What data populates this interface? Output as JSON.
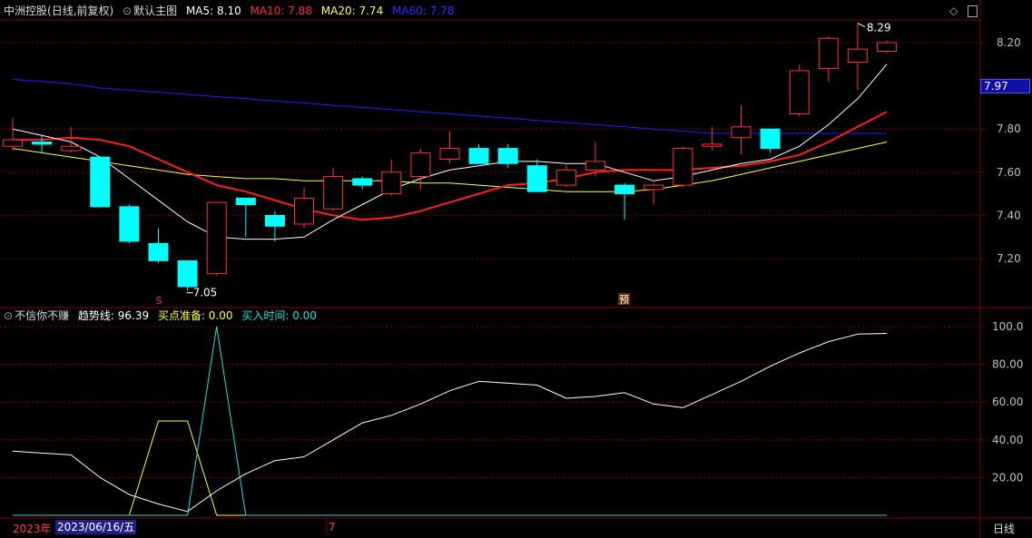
{
  "main_header": {
    "name": "中洲控股",
    "period": "(日线,前复权)",
    "chart_name": "默认主图",
    "ma5": "MA5: 8.10",
    "ma10": "MA10: 7.88",
    "ma20": "MA20: 7.74",
    "ma60": "MA60: 7.78"
  },
  "sub_header": {
    "name": "不信你不赚",
    "trend": "趋势线: 96.39",
    "buy_prep": "买点准备: 0.00",
    "buy_time": "买入时间: 0.00"
  },
  "colors": {
    "bg": "#000000",
    "up": "#ff3232",
    "down": "#00ffff",
    "ma5": "#ffffff",
    "ma10": "#ff2020",
    "ma20": "#ffff40",
    "ma60": "#2020ff",
    "grid": "#800000",
    "axis_text": "#c0c0c0"
  },
  "price_axis_labels": [
    "8.20",
    "7.80",
    "7.60",
    "7.40",
    "7.20"
  ],
  "current_price_tag": "7.97",
  "sub_axis_labels": [
    "100.0",
    "80.00",
    "60.00",
    "40.00",
    "20.00"
  ],
  "date_bar": {
    "year_label": "2023年",
    "cursor_date": "2023/06/16/五",
    "month_label": "7",
    "period_button": "日线"
  },
  "annotations": {
    "high_label": "8.29",
    "low_label": "7.05",
    "marker_s": "S",
    "marker_yu": "预"
  },
  "chart_data": [
    {
      "type": "candlestick",
      "ylim": [
        7.05,
        8.29
      ],
      "candles": [
        {
          "o": 7.72,
          "h": 7.85,
          "l": 7.7,
          "c": 7.75
        },
        {
          "o": 7.74,
          "h": 7.77,
          "l": 7.69,
          "c": 7.73
        },
        {
          "o": 7.7,
          "h": 7.81,
          "l": 7.69,
          "c": 7.72
        },
        {
          "o": 7.67,
          "h": 7.67,
          "l": 7.44,
          "c": 7.44
        },
        {
          "o": 7.44,
          "h": 7.45,
          "l": 7.27,
          "c": 7.28
        },
        {
          "o": 7.27,
          "h": 7.34,
          "l": 7.18,
          "c": 7.19
        },
        {
          "o": 7.19,
          "h": 7.19,
          "l": 7.05,
          "c": 7.07
        },
        {
          "o": 7.13,
          "h": 7.46,
          "l": 7.12,
          "c": 7.46
        },
        {
          "o": 7.48,
          "h": 7.48,
          "l": 7.3,
          "c": 7.45
        },
        {
          "o": 7.4,
          "h": 7.42,
          "l": 7.28,
          "c": 7.35
        },
        {
          "o": 7.36,
          "h": 7.53,
          "l": 7.34,
          "c": 7.48
        },
        {
          "o": 7.43,
          "h": 7.62,
          "l": 7.42,
          "c": 7.58
        },
        {
          "o": 7.57,
          "h": 7.58,
          "l": 7.52,
          "c": 7.54
        },
        {
          "o": 7.5,
          "h": 7.66,
          "l": 7.49,
          "c": 7.6
        },
        {
          "o": 7.58,
          "h": 7.71,
          "l": 7.52,
          "c": 7.69
        },
        {
          "o": 7.66,
          "h": 7.79,
          "l": 7.64,
          "c": 7.71
        },
        {
          "o": 7.71,
          "h": 7.73,
          "l": 7.64,
          "c": 7.64
        },
        {
          "o": 7.71,
          "h": 7.73,
          "l": 7.62,
          "c": 7.64
        },
        {
          "o": 7.63,
          "h": 7.66,
          "l": 7.51,
          "c": 7.51
        },
        {
          "o": 7.54,
          "h": 7.64,
          "l": 7.53,
          "c": 7.61
        },
        {
          "o": 7.61,
          "h": 7.74,
          "l": 7.58,
          "c": 7.65
        },
        {
          "o": 7.54,
          "h": 7.55,
          "l": 7.38,
          "c": 7.5
        },
        {
          "o": 7.52,
          "h": 7.55,
          "l": 7.45,
          "c": 7.54
        },
        {
          "o": 7.54,
          "h": 7.72,
          "l": 7.53,
          "c": 7.71
        },
        {
          "o": 7.72,
          "h": 7.81,
          "l": 7.7,
          "c": 7.73
        },
        {
          "o": 7.76,
          "h": 7.91,
          "l": 7.68,
          "c": 7.81
        },
        {
          "o": 7.8,
          "h": 7.8,
          "l": 7.69,
          "c": 7.71
        },
        {
          "o": 7.87,
          "h": 8.1,
          "l": 7.86,
          "c": 8.07
        },
        {
          "o": 8.08,
          "h": 8.23,
          "l": 8.02,
          "c": 8.22
        },
        {
          "o": 8.11,
          "h": 8.29,
          "l": 7.98,
          "c": 8.17
        },
        {
          "o": 8.16,
          "h": 8.21,
          "l": 8.15,
          "c": 8.2
        }
      ],
      "ma5": [
        7.8,
        7.77,
        7.74,
        7.67,
        7.57,
        7.47,
        7.37,
        7.3,
        7.29,
        7.29,
        7.3,
        7.38,
        7.45,
        7.52,
        7.57,
        7.61,
        7.63,
        7.65,
        7.65,
        7.64,
        7.64,
        7.6,
        7.56,
        7.58,
        7.61,
        7.64,
        7.66,
        7.72,
        7.82,
        7.94,
        8.1
      ],
      "ma10": [
        7.75,
        7.75,
        7.76,
        7.75,
        7.72,
        7.66,
        7.6,
        7.54,
        7.51,
        7.47,
        7.43,
        7.4,
        7.38,
        7.39,
        7.42,
        7.46,
        7.5,
        7.54,
        7.55,
        7.57,
        7.6,
        7.61,
        7.61,
        7.61,
        7.62,
        7.63,
        7.65,
        7.68,
        7.74,
        7.81,
        7.88
      ],
      "ma20": [
        7.71,
        7.69,
        7.67,
        7.65,
        7.63,
        7.61,
        7.59,
        7.58,
        7.57,
        7.57,
        7.56,
        7.56,
        7.56,
        7.56,
        7.55,
        7.55,
        7.54,
        7.53,
        7.52,
        7.51,
        7.51,
        7.51,
        7.52,
        7.54,
        7.56,
        7.59,
        7.62,
        7.65,
        7.68,
        7.71,
        7.74
      ],
      "ma60": [
        8.03,
        8.02,
        8.01,
        7.99,
        7.98,
        7.97,
        7.96,
        7.95,
        7.94,
        7.93,
        7.92,
        7.91,
        7.9,
        7.89,
        7.88,
        7.87,
        7.86,
        7.85,
        7.84,
        7.83,
        7.82,
        7.81,
        7.8,
        7.79,
        7.78,
        7.78,
        7.78,
        7.78,
        7.78,
        7.78,
        7.78
      ]
    },
    {
      "type": "line",
      "ylim": [
        0,
        100
      ],
      "series": [
        {
          "name": "趋势线",
          "values": [
            34,
            33,
            32,
            20,
            11,
            6,
            2,
            13,
            22,
            29,
            31,
            40,
            49,
            53,
            59,
            66,
            71,
            70,
            69,
            62,
            63,
            65,
            59,
            57,
            64,
            71,
            79,
            86,
            92,
            96,
            96.39
          ]
        },
        {
          "name": "买点准备",
          "values": [
            0,
            0,
            0,
            0,
            0,
            50,
            50,
            0,
            0,
            0,
            0,
            0,
            0,
            0,
            0,
            0,
            0,
            0,
            0,
            0,
            0,
            0,
            0,
            0,
            0,
            0,
            0,
            0,
            0,
            0,
            0
          ]
        },
        {
          "name": "买入时间",
          "values": [
            0,
            0,
            0,
            0,
            0,
            0,
            0,
            100,
            0,
            0,
            0,
            0,
            0,
            0,
            0,
            0,
            0,
            0,
            0,
            0,
            0,
            0,
            0,
            0,
            0,
            0,
            0,
            0,
            0,
            0,
            0
          ]
        }
      ]
    }
  ]
}
